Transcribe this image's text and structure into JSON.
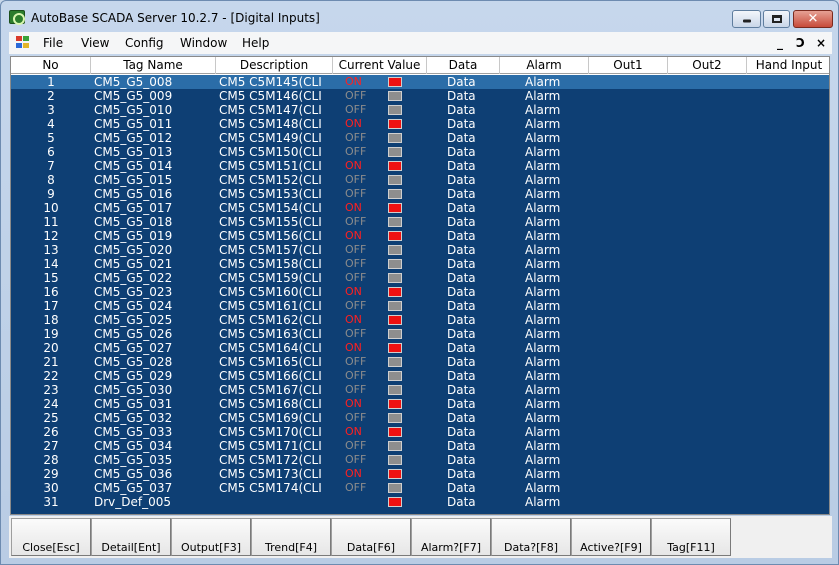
{
  "window": {
    "title": "AutoBase SCADA Server 10.2.7 - [Digital Inputs]"
  },
  "menu": {
    "items": [
      "File",
      "View",
      "Config",
      "Window",
      "Help"
    ],
    "mdi_controls": [
      "_",
      "Ɔ",
      "×"
    ]
  },
  "table": {
    "columns": [
      "No",
      "Tag Name",
      "Description",
      "Current Value",
      "Data",
      "Alarm",
      "Out1",
      "Out2",
      "Hand Input"
    ],
    "rows": [
      {
        "no": "1",
        "tag": "CM5_G5_008",
        "desc": "CM5  C5M145(CLI",
        "value": "ON",
        "state": "on",
        "data": "Data",
        "alarm": "Alarm"
      },
      {
        "no": "2",
        "tag": "CM5_G5_009",
        "desc": "CM5  C5M146(CLI",
        "value": "OFF",
        "state": "off",
        "data": "Data",
        "alarm": "Alarm"
      },
      {
        "no": "3",
        "tag": "CM5_G5_010",
        "desc": "CM5  C5M147(CLI",
        "value": "OFF",
        "state": "off",
        "data": "Data",
        "alarm": "Alarm"
      },
      {
        "no": "4",
        "tag": "CM5_G5_011",
        "desc": "CM5  C5M148(CLI",
        "value": "ON",
        "state": "on",
        "data": "Data",
        "alarm": "Alarm"
      },
      {
        "no": "5",
        "tag": "CM5_G5_012",
        "desc": "CM5  C5M149(CLI",
        "value": "OFF",
        "state": "off",
        "data": "Data",
        "alarm": "Alarm"
      },
      {
        "no": "6",
        "tag": "CM5_G5_013",
        "desc": "CM5  C5M150(CLI",
        "value": "OFF",
        "state": "off",
        "data": "Data",
        "alarm": "Alarm"
      },
      {
        "no": "7",
        "tag": "CM5_G5_014",
        "desc": "CM5  C5M151(CLI",
        "value": "ON",
        "state": "on",
        "data": "Data",
        "alarm": "Alarm"
      },
      {
        "no": "8",
        "tag": "CM5_G5_015",
        "desc": "CM5  C5M152(CLI",
        "value": "OFF",
        "state": "off",
        "data": "Data",
        "alarm": "Alarm"
      },
      {
        "no": "9",
        "tag": "CM5_G5_016",
        "desc": "CM5  C5M153(CLI",
        "value": "OFF",
        "state": "off",
        "data": "Data",
        "alarm": "Alarm"
      },
      {
        "no": "10",
        "tag": "CM5_G5_017",
        "desc": "CM5  C5M154(CLI",
        "value": "ON",
        "state": "on",
        "data": "Data",
        "alarm": "Alarm"
      },
      {
        "no": "11",
        "tag": "CM5_G5_018",
        "desc": "CM5  C5M155(CLI",
        "value": "OFF",
        "state": "off",
        "data": "Data",
        "alarm": "Alarm"
      },
      {
        "no": "12",
        "tag": "CM5_G5_019",
        "desc": "CM5  C5M156(CLI",
        "value": "ON",
        "state": "on",
        "data": "Data",
        "alarm": "Alarm"
      },
      {
        "no": "13",
        "tag": "CM5_G5_020",
        "desc": "CM5  C5M157(CLI",
        "value": "OFF",
        "state": "off",
        "data": "Data",
        "alarm": "Alarm"
      },
      {
        "no": "14",
        "tag": "CM5_G5_021",
        "desc": "CM5  C5M158(CLI",
        "value": "OFF",
        "state": "off",
        "data": "Data",
        "alarm": "Alarm"
      },
      {
        "no": "15",
        "tag": "CM5_G5_022",
        "desc": "CM5  C5M159(CLI",
        "value": "OFF",
        "state": "off",
        "data": "Data",
        "alarm": "Alarm"
      },
      {
        "no": "16",
        "tag": "CM5_G5_023",
        "desc": "CM5  C5M160(CLI",
        "value": "ON",
        "state": "on",
        "data": "Data",
        "alarm": "Alarm"
      },
      {
        "no": "17",
        "tag": "CM5_G5_024",
        "desc": "CM5  C5M161(CLI",
        "value": "OFF",
        "state": "off",
        "data": "Data",
        "alarm": "Alarm"
      },
      {
        "no": "18",
        "tag": "CM5_G5_025",
        "desc": "CM5  C5M162(CLI",
        "value": "ON",
        "state": "on",
        "data": "Data",
        "alarm": "Alarm"
      },
      {
        "no": "19",
        "tag": "CM5_G5_026",
        "desc": "CM5  C5M163(CLI",
        "value": "OFF",
        "state": "off",
        "data": "Data",
        "alarm": "Alarm"
      },
      {
        "no": "20",
        "tag": "CM5_G5_027",
        "desc": "CM5  C5M164(CLI",
        "value": "ON",
        "state": "on",
        "data": "Data",
        "alarm": "Alarm"
      },
      {
        "no": "21",
        "tag": "CM5_G5_028",
        "desc": "CM5  C5M165(CLI",
        "value": "OFF",
        "state": "off",
        "data": "Data",
        "alarm": "Alarm"
      },
      {
        "no": "22",
        "tag": "CM5_G5_029",
        "desc": "CM5  C5M166(CLI",
        "value": "OFF",
        "state": "off",
        "data": "Data",
        "alarm": "Alarm"
      },
      {
        "no": "23",
        "tag": "CM5_G5_030",
        "desc": "CM5  C5M167(CLI",
        "value": "OFF",
        "state": "off",
        "data": "Data",
        "alarm": "Alarm"
      },
      {
        "no": "24",
        "tag": "CM5_G5_031",
        "desc": "CM5  C5M168(CLI",
        "value": "ON",
        "state": "on",
        "data": "Data",
        "alarm": "Alarm"
      },
      {
        "no": "25",
        "tag": "CM5_G5_032",
        "desc": "CM5  C5M169(CLI",
        "value": "OFF",
        "state": "off",
        "data": "Data",
        "alarm": "Alarm"
      },
      {
        "no": "26",
        "tag": "CM5_G5_033",
        "desc": "CM5  C5M170(CLI",
        "value": "ON",
        "state": "on",
        "data": "Data",
        "alarm": "Alarm"
      },
      {
        "no": "27",
        "tag": "CM5_G5_034",
        "desc": "CM5  C5M171(CLI",
        "value": "OFF",
        "state": "off",
        "data": "Data",
        "alarm": "Alarm"
      },
      {
        "no": "28",
        "tag": "CM5_G5_035",
        "desc": "CM5  C5M172(CLI",
        "value": "OFF",
        "state": "off",
        "data": "Data",
        "alarm": "Alarm"
      },
      {
        "no": "29",
        "tag": "CM5_G5_036",
        "desc": "CM5  C5M173(CLI",
        "value": "ON",
        "state": "on",
        "data": "Data",
        "alarm": "Alarm"
      },
      {
        "no": "30",
        "tag": "CM5_G5_037",
        "desc": "CM5  C5M174(CLI",
        "value": "OFF",
        "state": "off",
        "data": "Data",
        "alarm": "Alarm"
      },
      {
        "no": "31",
        "tag": "Drv_Def_005",
        "desc": "",
        "value": "",
        "state": "on",
        "data": "Data",
        "alarm": "Alarm"
      }
    ]
  },
  "function_buttons": [
    "Close[Esc]",
    "Detail[Ent]",
    "Output[F3]",
    "Trend[F4]",
    "Data[F6]",
    "Alarm?[F7]",
    "Data?[F8]",
    "Active?[F9]",
    "Tag[F11]"
  ],
  "colors": {
    "grid_bg": "#0e3f74",
    "selected_row": "#2b6da8",
    "on_color": "#ff2020",
    "off_color": "#8c8c8c"
  }
}
